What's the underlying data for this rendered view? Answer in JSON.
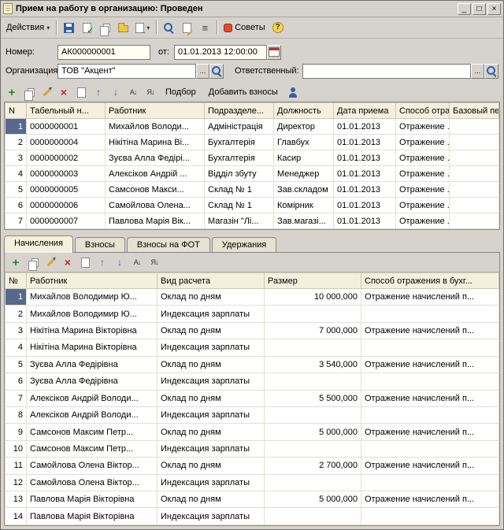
{
  "window": {
    "title": "Прием на работу в организацию: Проведен",
    "controls": {
      "minimize": "_",
      "maximize": "□",
      "close": "×"
    }
  },
  "icons": {
    "dropdown_arrow": "▾",
    "list": "≡",
    "help": "?",
    "add": "+",
    "delete": "×",
    "up": "↑",
    "down": "↓",
    "sort_asc": "А↓",
    "sort_desc": "Я↓",
    "ellipsis": "..."
  },
  "toolbar": {
    "actions_label": "Действия",
    "tips_label": "Советы"
  },
  "form": {
    "number_label": "Номер:",
    "number_value": "АК000000001",
    "date_label": "от:",
    "date_value": "01.01.2013 12:00:00",
    "org_label": "Организация:",
    "org_value": "ТОВ \"Акцент\"",
    "responsible_label": "Ответственный:",
    "responsible_value": ""
  },
  "employees_toolbar": {
    "pick_label": "Подбор",
    "add_contrib_label": "Добавить взносы"
  },
  "employees_table": {
    "columns": [
      "N",
      "Табельный н...",
      "Работник",
      "Подразделе...",
      "Должность",
      "Дата приема",
      "Способ отра...",
      "Базовый пер..."
    ],
    "rows": [
      [
        "1",
        "0000000001",
        "Михайлов Володи...",
        "Адміністрація",
        "Директор",
        "01.01.2013",
        "Отражение ...",
        ""
      ],
      [
        "2",
        "0000000004",
        "Нікітіна Марина Ві...",
        "Бухгалтерія",
        "Главбух",
        "01.01.2013",
        "Отражение ...",
        ""
      ],
      [
        "3",
        "0000000002",
        "Зуєва Алла Федірі...",
        "Бухгалтерія",
        "Касир",
        "01.01.2013",
        "Отражение ...",
        ""
      ],
      [
        "4",
        "0000000003",
        "Алексіков Андрій ...",
        "Відділ збуту",
        "Менеджер",
        "01.01.2013",
        "Отражение ...",
        ""
      ],
      [
        "5",
        "0000000005",
        "Самсонов Макси...",
        "Склад № 1",
        "Зав.складом",
        "01.01.2013",
        "Отражение ...",
        ""
      ],
      [
        "6",
        "0000000006",
        "Самойлова Олена...",
        "Склад № 1",
        "Комірник",
        "01.01.2013",
        "Отражение ...",
        ""
      ],
      [
        "7",
        "0000000007",
        "Павлова Марія Вік...",
        "Магазін \"Лі...",
        "Зав.магазі...",
        "01.01.2013",
        "Отражение ...",
        ""
      ]
    ]
  },
  "tabs": [
    "Начисления",
    "Взносы",
    "Взносы на ФОТ",
    "Удержания"
  ],
  "accruals_table": {
    "columns": [
      "№",
      "Работник",
      "Вид расчета",
      "Размер",
      "Способ отражения в бухг..."
    ],
    "rows": [
      [
        "1",
        "Михайлов Володимир Ю...",
        "Оклад по дням",
        "10 000,000",
        "Отражение начислений п..."
      ],
      [
        "2",
        "Михайлов Володимир Ю...",
        "Индексация зарплаты",
        "",
        ""
      ],
      [
        "3",
        "Нікітіна Марина Вікторівна",
        "Оклад по дням",
        "7 000,000",
        "Отражение начислений п..."
      ],
      [
        "4",
        "Нікітіна Марина Вікторівна",
        "Индексация зарплаты",
        "",
        ""
      ],
      [
        "5",
        "Зуєва Алла Федірівна",
        "Оклад по дням",
        "3 540,000",
        "Отражение начислений п..."
      ],
      [
        "6",
        "Зуєва Алла Федірівна",
        "Индексация зарплаты",
        "",
        ""
      ],
      [
        "7",
        "Алексіков Андрій Володи...",
        "Оклад по дням",
        "5 500,000",
        "Отражение начислений п..."
      ],
      [
        "8",
        "Алексіков Андрій Володи...",
        "Индексация зарплаты",
        "",
        ""
      ],
      [
        "9",
        "Самсонов Максим Петр...",
        "Оклад по дням",
        "5 000,000",
        "Отражение начислений п..."
      ],
      [
        "10",
        "Самсонов Максим Петр...",
        "Индексация зарплаты",
        "",
        ""
      ],
      [
        "11",
        "Самойлова Олена Віктор...",
        "Оклад по дням",
        "2 700,000",
        "Отражение начислений п..."
      ],
      [
        "12",
        "Самойлова Олена Віктор...",
        "Индексация зарплаты",
        "",
        ""
      ],
      [
        "13",
        "Павлова Марія Вікторівна",
        "Оклад по дням",
        "5 000,000",
        "Отражение начислений п..."
      ],
      [
        "14",
        "Павлова Марія Вікторівна",
        "Индексация зарплаты",
        "",
        ""
      ]
    ]
  }
}
